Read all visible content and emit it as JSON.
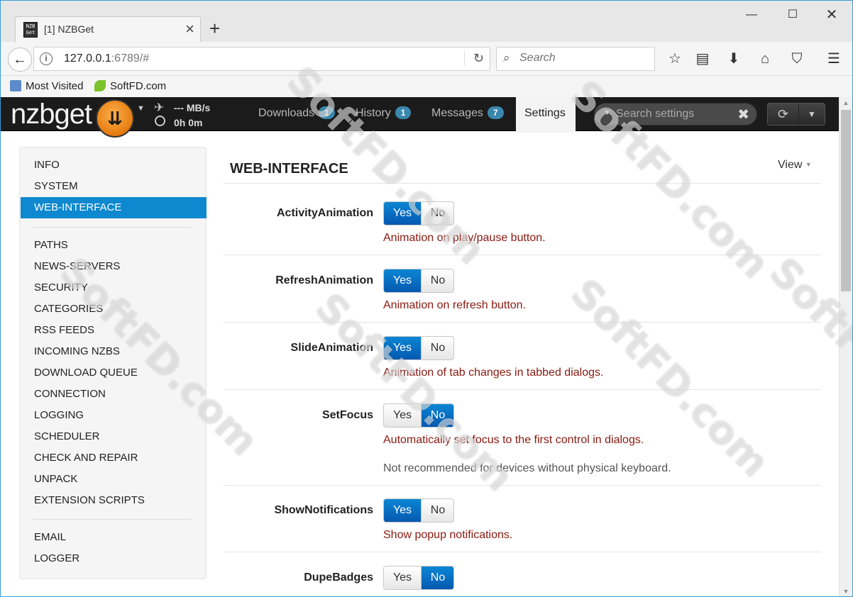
{
  "browser": {
    "tab_title": "[1] NZBGet",
    "favicon_text": "NZB Get",
    "url_host": "127.0.0.1",
    "url_rest": ":6789/#",
    "search_placeholder": "Search",
    "bookmarks": [
      "Most Visited",
      "SoftFD.com"
    ]
  },
  "app": {
    "logo": "nzbget",
    "speed": "--- MB/s",
    "time_left": "0h 0m",
    "tabs": [
      {
        "label": "Downloads",
        "badge": "1"
      },
      {
        "label": "History",
        "badge": "1"
      },
      {
        "label": "Messages",
        "badge": "7"
      },
      {
        "label": "Settings"
      }
    ],
    "settings_search_placeholder": "Search settings"
  },
  "sidebar": {
    "items_group1": [
      "INFO",
      "SYSTEM",
      "WEB-INTERFACE"
    ],
    "active": "WEB-INTERFACE",
    "items_group2": [
      "PATHS",
      "NEWS-SERVERS",
      "SECURITY",
      "CATEGORIES",
      "RSS FEEDS",
      "INCOMING NZBS",
      "DOWNLOAD QUEUE",
      "CONNECTION",
      "LOGGING",
      "SCHEDULER",
      "CHECK AND REPAIR",
      "UNPACK",
      "EXTENSION SCRIPTS"
    ],
    "items_group3": [
      "EMAIL",
      "LOGGER"
    ]
  },
  "main": {
    "title": "WEB-INTERFACE",
    "view_label": "View",
    "yes_label": "Yes",
    "no_label": "No",
    "options": [
      {
        "name": "ActivityAnimation",
        "value": "Yes",
        "desc": "Animation on play/pause button."
      },
      {
        "name": "RefreshAnimation",
        "value": "Yes",
        "desc": "Animation on refresh button."
      },
      {
        "name": "SlideAnimation",
        "value": "Yes",
        "desc": "Animation of tab changes in tabbed dialogs."
      },
      {
        "name": "SetFocus",
        "value": "No",
        "desc": "Automatically set focus to the first control in dialogs.",
        "note": "Not recommended for devices without physical keyboard."
      },
      {
        "name": "ShowNotifications",
        "value": "Yes",
        "desc": "Show popup notifications."
      },
      {
        "name": "DupeBadges",
        "value": "No"
      }
    ]
  },
  "watermark": "SoftFD.com",
  "colors": {
    "accent": "#0e88cf",
    "badge": "#3a87ad",
    "desc": "#8a1a10",
    "topbar": "#1b1b1b"
  }
}
